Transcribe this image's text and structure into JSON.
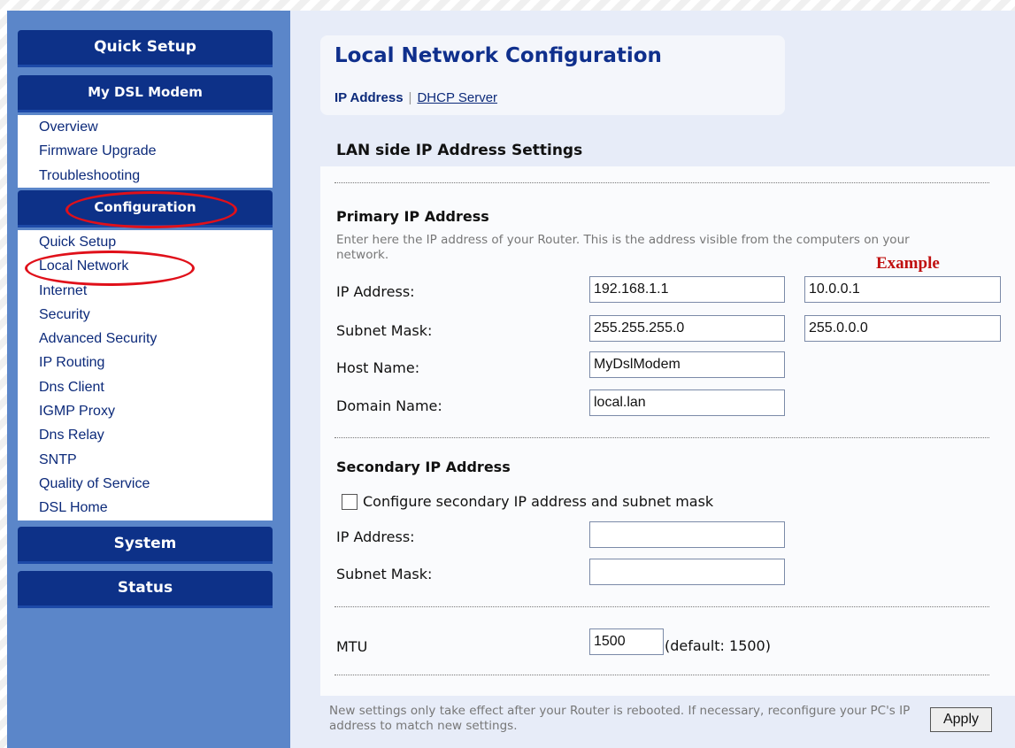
{
  "sidebar": {
    "quick_setup": "Quick Setup",
    "my_dsl_modem": "My DSL Modem",
    "modem_items": [
      "Overview",
      "Firmware Upgrade",
      "Troubleshooting"
    ],
    "configuration": "Configuration",
    "config_items": [
      "Quick Setup",
      "Local Network",
      "Internet",
      "Security",
      "Advanced Security",
      "IP Routing",
      "Dns Client",
      "IGMP Proxy",
      "Dns Relay",
      "SNTP",
      "Quality of Service",
      "DSL Home"
    ],
    "system": "System",
    "status": "Status"
  },
  "main": {
    "title": "Local Network Configuration",
    "tabs": [
      {
        "label": "IP Address",
        "active": true
      },
      {
        "label": "DHCP Server",
        "active": false
      }
    ],
    "tab_separator": "|",
    "section_title": "LAN side IP Address Settings",
    "primary": {
      "heading": "Primary IP Address",
      "description": "Enter here the IP address of your Router. This is the address visible from the computers on your network.",
      "example_label": "Example",
      "ip_label": "IP Address:",
      "ip_value": "192.168.1.1",
      "ip_example": "10.0.0.1",
      "mask_label": "Subnet Mask:",
      "mask_value": "255.255.255.0",
      "mask_example": "255.0.0.0",
      "host_label": "Host Name:",
      "host_value": "MyDslModem",
      "domain_label": "Domain Name:",
      "domain_value": "local.lan"
    },
    "secondary": {
      "heading": "Secondary IP Address",
      "checkbox_label": "Configure secondary IP address and subnet mask",
      "checked": false,
      "ip_label": "IP Address:",
      "ip_value": "",
      "mask_label": "Subnet Mask:",
      "mask_value": ""
    },
    "mtu": {
      "label": "MTU",
      "value": "1500",
      "default_note": "(default: 1500)"
    },
    "footer_note": "New settings only take effect after your Router is rebooted. If necessary, reconfigure your PC's IP address to match new settings.",
    "apply_label": "Apply"
  },
  "colors": {
    "nav_header": "#0d3188",
    "sidebar_bg": "#5b86c9",
    "highlight_ring": "#e0101a",
    "example_text": "#c01010"
  }
}
